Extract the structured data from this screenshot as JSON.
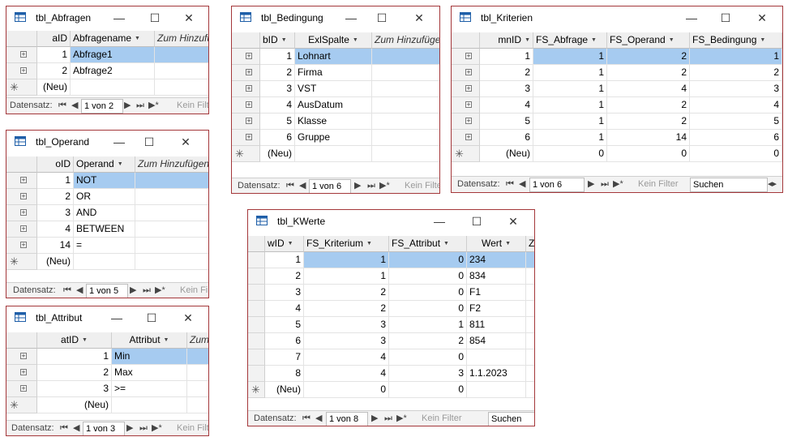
{
  "windows": {
    "abfragen": {
      "title": "tbl_Abfragen",
      "headers": [
        "aID",
        "Abfragename",
        "Zum Hinzufügen"
      ],
      "rows": [
        [
          "1",
          "Abfrage1"
        ],
        [
          "2",
          "Abfrage2"
        ]
      ],
      "new_row": "(Neu)",
      "nav": {
        "label": "Datensatz:",
        "record": "1 von 2",
        "filter": "Kein Filter"
      }
    },
    "operand": {
      "title": "tbl_Operand",
      "headers": [
        "oID",
        "Operand",
        "Zum Hinzufügen"
      ],
      "rows": [
        [
          "1",
          "NOT"
        ],
        [
          "2",
          "OR"
        ],
        [
          "3",
          "AND"
        ],
        [
          "4",
          "BETWEEN"
        ],
        [
          "14",
          "="
        ]
      ],
      "new_row": "(Neu)",
      "nav": {
        "label": "Datensatz:",
        "record": "1 von 5",
        "filter": "Kein Filter"
      }
    },
    "attribut": {
      "title": "tbl_Attribut",
      "headers": [
        "atID",
        "Attribut",
        "Zum Hinzufügen"
      ],
      "rows": [
        [
          "1",
          "Min"
        ],
        [
          "2",
          "Max"
        ],
        [
          "3",
          ">="
        ]
      ],
      "new_row": "(Neu)",
      "nav": {
        "label": "Datensatz:",
        "record": "1 von 3",
        "filter": "Kein Filter"
      }
    },
    "bedingung": {
      "title": "tbl_Bedingung",
      "headers": [
        "bID",
        "ExlSpalte",
        "Zum Hinzufügen"
      ],
      "rows": [
        [
          "1",
          "Lohnart"
        ],
        [
          "2",
          "Firma"
        ],
        [
          "3",
          "VST"
        ],
        [
          "4",
          "AusDatum"
        ],
        [
          "5",
          "Klasse"
        ],
        [
          "6",
          "Gruppe"
        ]
      ],
      "new_row": "(Neu)",
      "nav": {
        "label": "Datensatz:",
        "record": "1 von 6",
        "filter": "Kein Filter"
      }
    },
    "kriterien": {
      "title": "tbl_Kriterien",
      "headers": [
        "mnID",
        "FS_Abfrage",
        "FS_Operand",
        "FS_Bedingung"
      ],
      "rows": [
        [
          "1",
          "1",
          "2",
          "1"
        ],
        [
          "2",
          "1",
          "2",
          "2"
        ],
        [
          "3",
          "1",
          "4",
          "3"
        ],
        [
          "4",
          "1",
          "2",
          "4"
        ],
        [
          "5",
          "1",
          "2",
          "5"
        ],
        [
          "6",
          "1",
          "14",
          "6"
        ]
      ],
      "new_row": [
        "(Neu)",
        "0",
        "0",
        "0"
      ],
      "nav": {
        "label": "Datensatz:",
        "record": "1 von 6",
        "filter": "Kein Filter",
        "search": "Suchen"
      }
    },
    "kwerte": {
      "title": "tbl_KWerte",
      "headers": [
        "wID",
        "FS_Kriterium",
        "FS_Attribut",
        "Wert",
        "Z"
      ],
      "rows": [
        [
          "1",
          "1",
          "0",
          "234"
        ],
        [
          "2",
          "1",
          "0",
          "834"
        ],
        [
          "3",
          "2",
          "0",
          "F1"
        ],
        [
          "4",
          "2",
          "0",
          "F2"
        ],
        [
          "5",
          "3",
          "1",
          "811"
        ],
        [
          "6",
          "3",
          "2",
          "854"
        ],
        [
          "7",
          "4",
          "0",
          ""
        ],
        [
          "8",
          "4",
          "3",
          "1.1.2023"
        ]
      ],
      "new_row": [
        "(Neu)",
        "0",
        "0",
        ""
      ],
      "nav": {
        "label": "Datensatz:",
        "record": "1 von 8",
        "filter": "Kein Filter",
        "search": "Suchen"
      }
    }
  },
  "buttons": {
    "minimize": "—",
    "maximize": "☐",
    "close": "✕"
  },
  "nav_glyphs": {
    "first": "⏮",
    "prev": "◀",
    "next": "▶",
    "last": "⏭",
    "new": "▶*"
  },
  "colors": {
    "border": "#a4373a",
    "highlight": "#a6cbf0"
  }
}
